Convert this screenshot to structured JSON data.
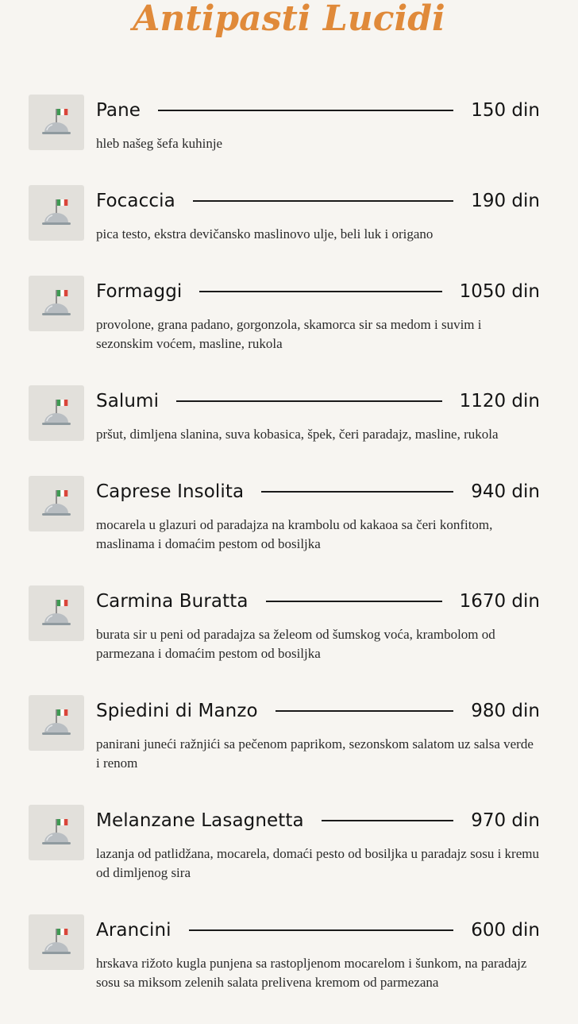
{
  "title": "Antipasti Lucidi",
  "colors": {
    "background": "#f7f5f1",
    "title": "#e08a3a",
    "text": "#141414",
    "thumbnail_bg": "#e2e0db"
  },
  "thumbnail_icon": "cloche-with-italian-flag-icon",
  "items": [
    {
      "name": "Pane",
      "price": "150 din",
      "description": "hleb našeg šefa kuhinje"
    },
    {
      "name": "Focaccia",
      "price": "190 din",
      "description": "pica testo, ekstra devičansko maslinovo ulje, beli luk i origano"
    },
    {
      "name": "Formaggi",
      "price": "1050 din",
      "description": "provolone, grana padano, gorgonzola, skamorca sir sa medom i suvim i sezonskim voćem, masline, rukola"
    },
    {
      "name": "Salumi",
      "price": "1120 din",
      "description": "pršut, dimljena slanina, suva kobasica, špek, čeri paradajz, masline, rukola"
    },
    {
      "name": "Caprese Insolita",
      "price": "940 din",
      "description": "mocarela u glazuri od paradajza na krambolu od kakaoa sa čeri konfitom, maslinama i domaćim pestom od bosiljka"
    },
    {
      "name": "Carmina Buratta",
      "price": "1670 din",
      "description": "burata sir u peni od paradajza sa želeom od šumskog voća, krambolom od parmezana i domaćim pestom od bosiljka"
    },
    {
      "name": "Spiedini di Manzo",
      "price": "980 din",
      "description": "panirani juneći ražnjići sa pečenom paprikom, sezonskom salatom uz salsa verde i renom"
    },
    {
      "name": "Melanzane Lasagnetta",
      "price": "970 din",
      "description": "lazanja od patlidžana, mocarela, domaći pesto od bosiljka u paradajz sosu i kremu od dimljenog sira"
    },
    {
      "name": "Arancini",
      "price": "600 din",
      "description": "hrskava rižoto kugla punjena sa rastopljenom mocarelom i šunkom, na paradajz sosu sa miksom zelenih salata prelivena kremom od parmezana"
    }
  ]
}
